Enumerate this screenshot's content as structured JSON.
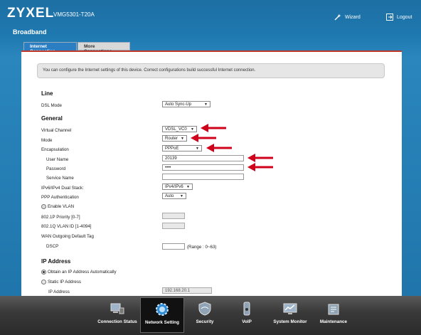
{
  "header": {
    "brand": "ZYXEL",
    "model": "VMG5301-T20A",
    "wizard_label": "Wizard",
    "logout_label": "Logout",
    "page_title": "Broadband"
  },
  "tabs": [
    {
      "label": "Internet Connection",
      "active": true
    },
    {
      "label": "More Connections",
      "active": false
    }
  ],
  "info_text": "You can configure the Internet settings of this device. Correct configurations build successful Internet connection.",
  "line": {
    "heading": "Line",
    "dsl_mode_label": "DSL Mode",
    "dsl_mode_value": "Auto Sync-Up"
  },
  "general": {
    "heading": "General",
    "virtual_channel_label": "Virtual Channel",
    "virtual_channel_value": "VDSL_VC0",
    "mode_label": "Mode",
    "mode_value": "Router",
    "encapsulation_label": "Encapsulation",
    "encapsulation_value": "PPPoE",
    "user_name_label": "User Name",
    "user_name_value": "20139",
    "password_label": "Password",
    "password_value": "••••",
    "service_name_label": "Service Name",
    "service_name_value": "",
    "dual_stack_label": "IPv6/IPv4 Dual Stack:",
    "dual_stack_value": "IPv4/IPv6",
    "ppp_auth_label": "PPP Authentication",
    "ppp_auth_value": "Auto",
    "enable_vlan_label": "Enable VLAN",
    "priority_label": "802.1P Priority [0-7]",
    "vlan_id_label": "802.1Q VLAN ID [1-4094]",
    "wan_tag_label": "WAN Outgoing Default Tag",
    "dscp_label": "DSCP",
    "dscp_value": "",
    "dscp_range": "(Range : 0~63)"
  },
  "ip_address": {
    "heading": "IP Address",
    "auto_label": "Obtain an IP Address Automatically",
    "static_label": "Static IP Address",
    "ip_label": "IP Address",
    "ip_value": "192.168.20.1"
  },
  "bottom_nav": [
    {
      "label": "Connection Status",
      "icon": "monitor-icon",
      "active": false
    },
    {
      "label": "Network Setting",
      "icon": "gear-globe-icon",
      "active": true
    },
    {
      "label": "Security",
      "icon": "shield-icon",
      "active": false
    },
    {
      "label": "VoIP",
      "icon": "phone-icon",
      "active": false
    },
    {
      "label": "System Monitor",
      "icon": "chart-monitor-icon",
      "active": false
    },
    {
      "label": "Maintenance",
      "icon": "tools-icon",
      "active": false
    }
  ],
  "colors": {
    "accent_red": "#c0392b",
    "header_blue": "#1e79b0",
    "annotation_arrow": "#d0021b"
  }
}
